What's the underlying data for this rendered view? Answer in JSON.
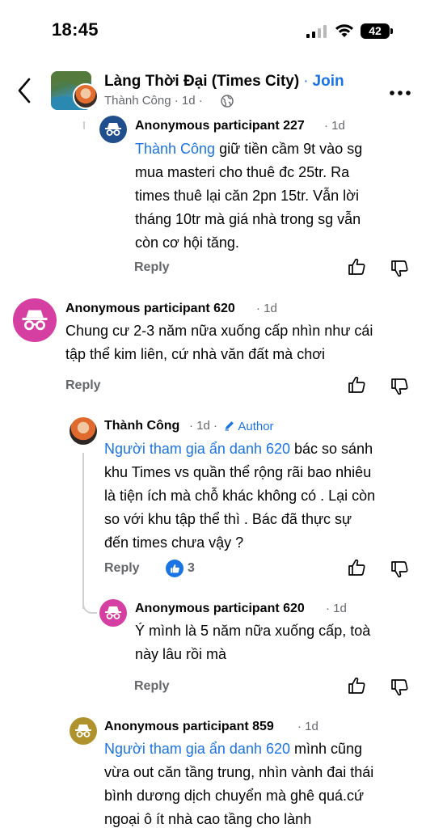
{
  "status_bar": {
    "time": "18:45",
    "battery": "42"
  },
  "header": {
    "group_name": "Làng Thời Đại (Times City)",
    "separator": "·",
    "join_label": "Join",
    "poster": "Thành Công",
    "age": "1d"
  },
  "comments": [
    {
      "name": "Anonymous participant 227",
      "time": "1d",
      "mention": "Thành Công",
      "lines": [
        " giữ tiền cầm 9t vào sg",
        "mua masteri cho thuê đc 25tr. Ra",
        "times thuê lại căn 2pn 15tr. Vẫn lời",
        "tháng 10tr mà giá nhà trong sg vẫn",
        "còn cơ hội tăng."
      ],
      "reply_label": "Reply"
    },
    {
      "name": "Anonymous participant 620",
      "time": "1d",
      "lines": [
        "Chung cư 2-3 năm nữa xuống cấp nhìn như cái",
        "tập thể kim liên, cứ nhà văn đất mà chơi"
      ],
      "reply_label": "Reply"
    },
    {
      "name": "Thành Công",
      "time": "1d",
      "author_label": "Author",
      "mention": "Người tham gia ẩn danh 620",
      "lines": [
        " bác so sánh",
        "khu Times vs quần thể rộng rãi bao nhiêu",
        "là tiện ích mà chỗ khác không có . Lại còn",
        "so với khu tập thể thì . Bác đã thực sự",
        "đến times chưa vậy ?"
      ],
      "reply_label": "Reply",
      "likes": "3"
    },
    {
      "name": "Anonymous participant 620",
      "time": "1d",
      "lines": [
        "Ý mình là 5 năm nữa xuống cấp, toà",
        "này lâu rồi mà"
      ],
      "reply_label": "Reply"
    },
    {
      "name": "Anonymous participant 859",
      "time": "1d",
      "mention": "Người tham gia ẩn danh 620",
      "lines": [
        " mình cũng",
        "vừa out căn tầng trung, nhìn vành đai thái",
        "bình dương dịch chuyển mà ghê quá.cứ",
        "ngoại ô ít nhà cao tầng cho lành"
      ]
    }
  ],
  "colors": {
    "accent": "#1b74e4",
    "secondary_text": "#65676b"
  }
}
